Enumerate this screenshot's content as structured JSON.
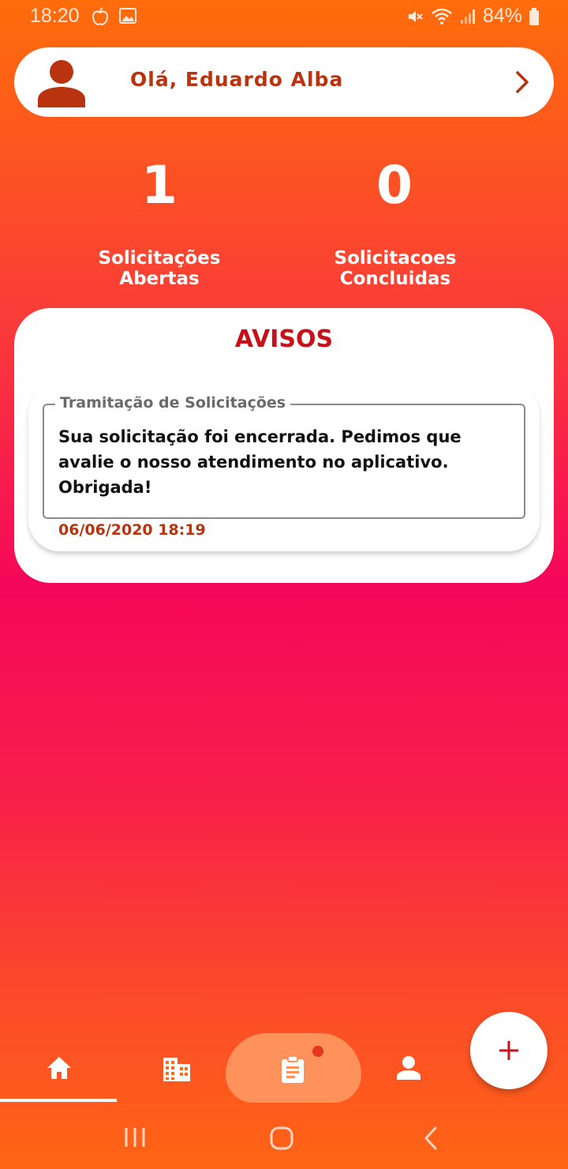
{
  "status_bar": {
    "time": "18:20",
    "battery": "84%"
  },
  "greeting": {
    "text": "Olá, Eduardo Alba"
  },
  "stats": {
    "open": {
      "value": "1",
      "label": "Solicitações Abertas"
    },
    "done": {
      "value": "0",
      "label": "Solicitacoes Concluidas"
    }
  },
  "avisos": {
    "title": "AVISOS",
    "notice": {
      "legend": "Tramitação de Solicitações",
      "message": "Sua solicitação foi encerrada. Pedimos que avalie o nosso atendimento no aplicativo. Obrigada!",
      "date": "06/06/2020 18:19"
    }
  },
  "bottom_nav": {
    "items": [
      {
        "icon": "home-icon",
        "active": true
      },
      {
        "icon": "building-icon",
        "active": false
      },
      {
        "icon": "clipboard-icon",
        "active": false,
        "badge": true
      },
      {
        "icon": "person-icon",
        "active": false
      }
    ]
  },
  "colors": {
    "accent": "#b8330e",
    "title_red": "#c8101a",
    "gradient_top": "#ff6d0a",
    "gradient_mid": "#f5075a",
    "gradient_bottom": "#ff6514"
  }
}
